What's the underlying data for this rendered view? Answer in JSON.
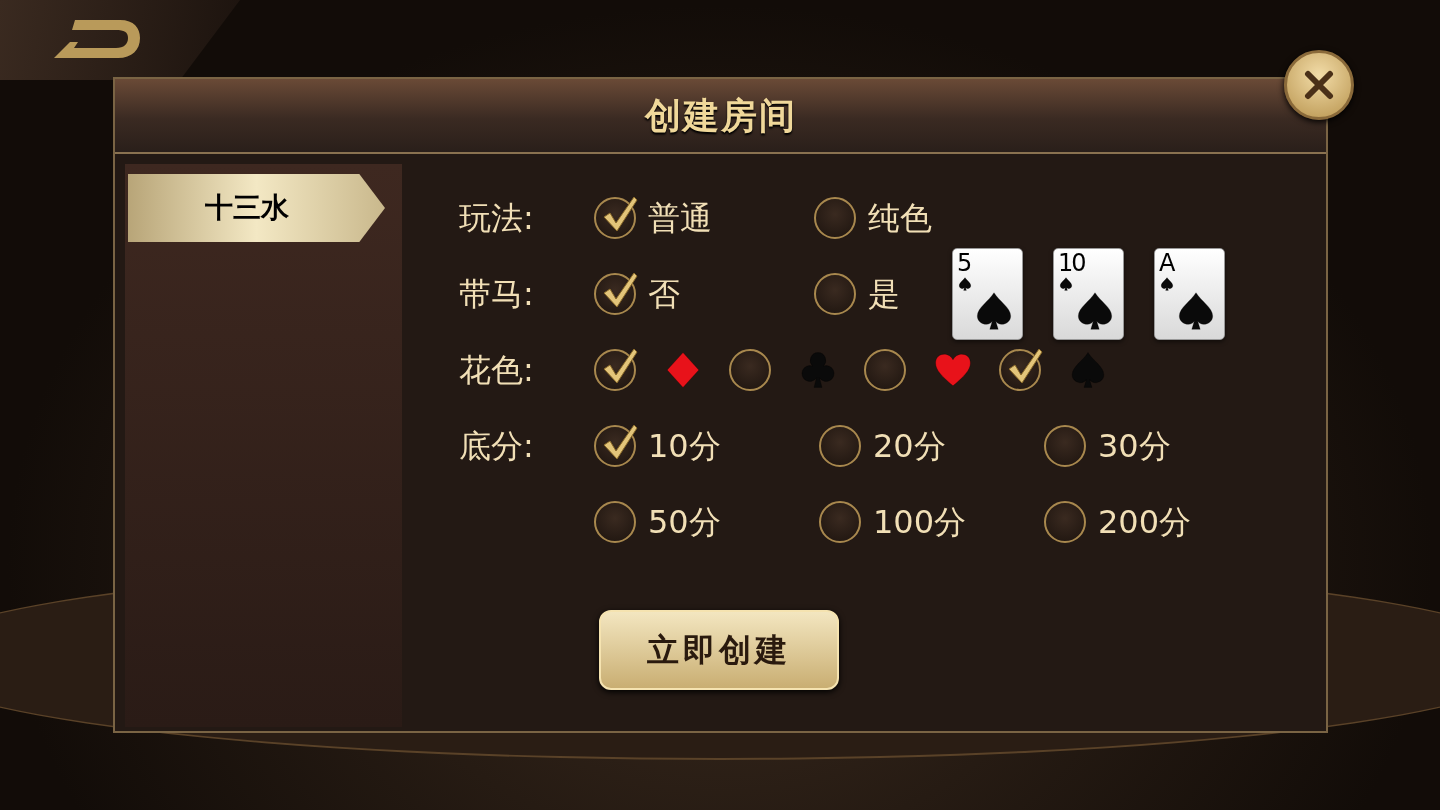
{
  "title": "创建房间",
  "games": [
    {
      "label": "十三水",
      "selected": true
    }
  ],
  "rows": [
    {
      "label": "玩法:",
      "kind": "options",
      "options": [
        {
          "label": "普通",
          "checked": true
        },
        {
          "label": "纯色",
          "checked": false
        }
      ]
    },
    {
      "label": "带马:",
      "kind": "options",
      "options": [
        {
          "label": "否",
          "checked": true
        },
        {
          "label": "是",
          "checked": false
        }
      ],
      "cards": [
        {
          "rank": "5"
        },
        {
          "rank": "10"
        },
        {
          "rank": "A"
        }
      ]
    },
    {
      "label": "花色:",
      "kind": "suits",
      "options": [
        {
          "kind": "diamond",
          "checked": true
        },
        {
          "kind": "club",
          "checked": false
        },
        {
          "kind": "heart",
          "checked": false
        },
        {
          "kind": "spade",
          "checked": true
        }
      ]
    },
    {
      "label": "底分:",
      "kind": "grid",
      "options": [
        {
          "label": "10分",
          "checked": true
        },
        {
          "label": "20分",
          "checked": false
        },
        {
          "label": "30分",
          "checked": false
        },
        {
          "label": "50分",
          "checked": false
        },
        {
          "label": "100分",
          "checked": false
        },
        {
          "label": "200分",
          "checked": false
        }
      ]
    }
  ],
  "create_button": "立即创建"
}
